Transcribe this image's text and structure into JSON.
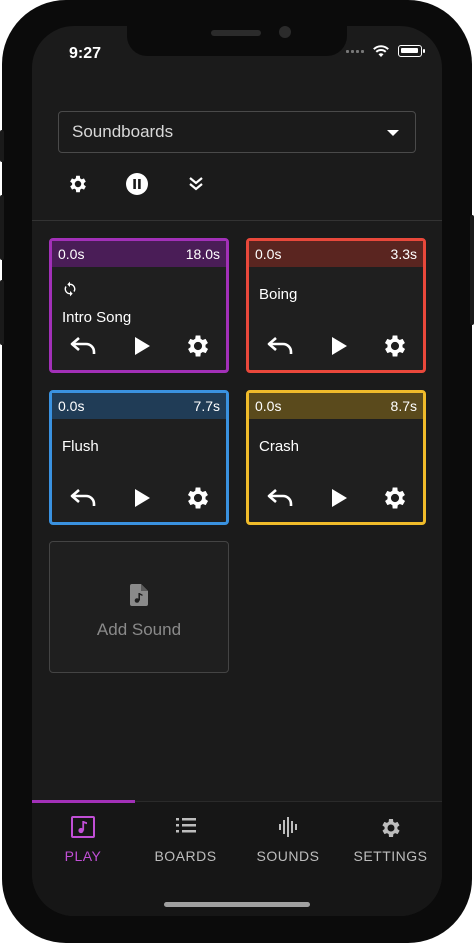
{
  "status": {
    "time": "9:27"
  },
  "header": {
    "board_select": "Soundboards"
  },
  "toolbar": {
    "settings_icon": "gear-icon",
    "pause_icon": "pause-circle-icon",
    "collapse_icon": "double-chevron-down-icon"
  },
  "cards": [
    {
      "name": "Intro Song",
      "start": "0.0s",
      "end": "18.0s",
      "color": "#a230b8",
      "head_bg": "#4a1d57",
      "loop": true
    },
    {
      "name": "Boing",
      "start": "0.0s",
      "end": "3.3s",
      "color": "#e9483b",
      "head_bg": "#5a2520",
      "loop": false
    },
    {
      "name": "Flush",
      "start": "0.0s",
      "end": "7.7s",
      "color": "#3a92e0",
      "head_bg": "#203c56",
      "loop": false
    },
    {
      "name": "Crash",
      "start": "0.0s",
      "end": "8.7s",
      "color": "#f0bb2a",
      "head_bg": "#5a4a1c",
      "loop": false
    }
  ],
  "add_sound": {
    "label": "Add Sound",
    "icon": "music-file-icon"
  },
  "tabs": [
    {
      "label": "PLAY",
      "icon": "music-note-square-icon",
      "active": true
    },
    {
      "label": "BOARDS",
      "icon": "list-icon",
      "active": false
    },
    {
      "label": "SOUNDS",
      "icon": "waveform-icon",
      "active": false
    },
    {
      "label": "SETTINGS",
      "icon": "gear-icon",
      "active": false
    }
  ]
}
